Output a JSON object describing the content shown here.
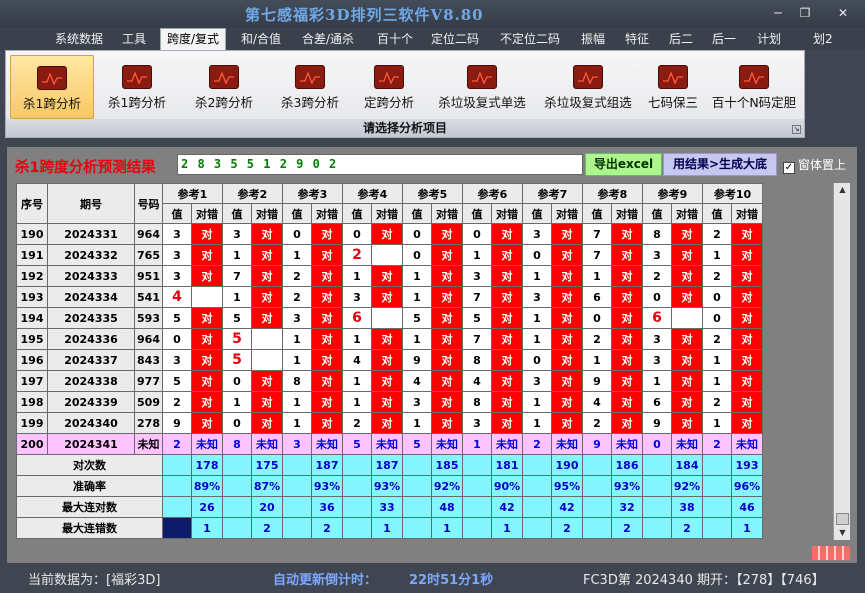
{
  "window": {
    "title": "第七感福彩3D排列三软件V8.80",
    "restore_glyph": "❐",
    "close_glyph": "✕",
    "min_glyph": "─"
  },
  "menu": [
    "系统数据",
    "工具",
    "跨度/复式",
    "和/合值",
    "合差/通杀",
    "百十个",
    "定位二码",
    "不定位二码",
    "振幅",
    "特征",
    "后二",
    "后一",
    "计划",
    "划2"
  ],
  "ribbon": {
    "buttons": [
      "杀1跨分析",
      "杀1跨分析",
      "杀2跨分析",
      "杀3跨分析",
      "定跨分析",
      "杀垃圾复式单选",
      "杀垃圾复式组选",
      "七码保三",
      "百十个N码定胆"
    ],
    "group_label": "请选择分析项目"
  },
  "result": {
    "label": "杀1跨度分析预测结果",
    "value": "2 8 3 5 5 1 2 9 0 2",
    "excel_btn": "导出excel",
    "gen_btn": "用结果>生成大底",
    "pin_label": "窗体置上",
    "pin_check": "✓"
  },
  "table": {
    "h_seq": "序号",
    "h_issue": "期号",
    "h_num": "号码",
    "h_val": "值",
    "h_ok": "对错",
    "ok_text": "对",
    "refs": [
      "参考1",
      "参考2",
      "参考3",
      "参考4",
      "参考5",
      "参考6",
      "参考7",
      "参考8",
      "参考9",
      "参考10"
    ],
    "rows": [
      {
        "seq": "190",
        "issue": "2024331",
        "num": "964",
        "vals": [
          "3",
          "3",
          "0",
          "0",
          "0",
          "0",
          "3",
          "7",
          "8",
          "2"
        ],
        "miss": []
      },
      {
        "seq": "191",
        "issue": "2024332",
        "num": "765",
        "vals": [
          "3",
          "1",
          "1",
          "2",
          "0",
          "1",
          "0",
          "7",
          "3",
          "1"
        ],
        "miss": [
          3
        ]
      },
      {
        "seq": "192",
        "issue": "2024333",
        "num": "951",
        "vals": [
          "3",
          "7",
          "2",
          "1",
          "1",
          "3",
          "1",
          "1",
          "2",
          "2"
        ],
        "miss": []
      },
      {
        "seq": "193",
        "issue": "2024334",
        "num": "541",
        "vals": [
          "4",
          "1",
          "2",
          "3",
          "1",
          "7",
          "3",
          "6",
          "0",
          "0"
        ],
        "miss": [
          0
        ]
      },
      {
        "seq": "194",
        "issue": "2024335",
        "num": "593",
        "vals": [
          "5",
          "5",
          "3",
          "6",
          "5",
          "5",
          "1",
          "0",
          "6",
          "0"
        ],
        "miss": [
          3,
          8
        ]
      },
      {
        "seq": "195",
        "issue": "2024336",
        "num": "964",
        "vals": [
          "0",
          "5",
          "1",
          "1",
          "1",
          "7",
          "1",
          "2",
          "3",
          "2"
        ],
        "miss": [
          1
        ]
      },
      {
        "seq": "196",
        "issue": "2024337",
        "num": "843",
        "vals": [
          "3",
          "5",
          "1",
          "4",
          "9",
          "8",
          "0",
          "1",
          "3",
          "1"
        ],
        "miss": [
          1
        ]
      },
      {
        "seq": "197",
        "issue": "2024338",
        "num": "977",
        "vals": [
          "5",
          "0",
          "8",
          "1",
          "4",
          "4",
          "3",
          "9",
          "1",
          "1"
        ],
        "miss": []
      },
      {
        "seq": "198",
        "issue": "2024339",
        "num": "509",
        "vals": [
          "2",
          "1",
          "1",
          "1",
          "3",
          "8",
          "1",
          "4",
          "6",
          "2"
        ],
        "miss": []
      },
      {
        "seq": "199",
        "issue": "2024340",
        "num": "278",
        "vals": [
          "9",
          "0",
          "1",
          "2",
          "1",
          "3",
          "1",
          "2",
          "9",
          "1"
        ],
        "miss": []
      }
    ],
    "pred": {
      "seq": "200",
      "issue": "2024341",
      "num": "未知",
      "vals": [
        "2",
        "8",
        "3",
        "5",
        "5",
        "1",
        "2",
        "9",
        "0",
        "2"
      ],
      "unknown": "未知"
    },
    "stats": [
      {
        "label": "对次数",
        "vals": [
          "178",
          "175",
          "187",
          "187",
          "185",
          "181",
          "190",
          "186",
          "184",
          "193"
        ]
      },
      {
        "label": "准确率",
        "vals": [
          "89%",
          "87%",
          "93%",
          "93%",
          "92%",
          "90%",
          "95%",
          "93%",
          "92%",
          "96%"
        ]
      },
      {
        "label": "最大连对数",
        "vals": [
          "26",
          "20",
          "36",
          "33",
          "48",
          "42",
          "42",
          "32",
          "38",
          "46"
        ]
      },
      {
        "label": "最大连错数",
        "vals": [
          "1",
          "2",
          "2",
          "1",
          "1",
          "1",
          "2",
          "2",
          "2",
          "1"
        ]
      }
    ]
  },
  "status": {
    "current": "当前数据为：[福彩3D]",
    "countdown_label": "自动更新倒计时：",
    "countdown": "22时51分1秒",
    "issue_info": "FC3D第 2024340 期开：【278】【746】"
  },
  "colors": {
    "hit": "#ff0000",
    "pred_row": "#ffc4ff",
    "stat_row": "#85f5ff",
    "title": "#6fa9e8"
  }
}
